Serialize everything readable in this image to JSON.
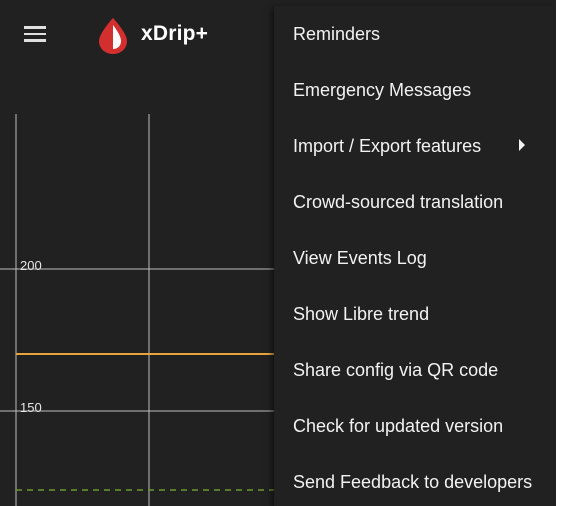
{
  "app": {
    "title": "xDrip+",
    "logo_icon": "blood-drop-icon",
    "menu_icon": "hamburger-menu-icon"
  },
  "chart": {
    "y_ticks": [
      "200",
      "150"
    ],
    "colors": {
      "grid": "#bdbdbd",
      "high_line": "#e8a33d",
      "low_line": "#6a9a2c"
    }
  },
  "menu": {
    "items": [
      {
        "label": "Reminders"
      },
      {
        "label": "Emergency Messages"
      },
      {
        "label": "Import / Export features",
        "submenu_icon": "arrow-right-icon"
      },
      {
        "label": "Crowd-sourced translation"
      },
      {
        "label": "View Events Log"
      },
      {
        "label": "Show Libre trend"
      },
      {
        "label": "Share config via QR code"
      },
      {
        "label": "Check for updated version"
      },
      {
        "label": "Send Feedback to developers"
      }
    ]
  }
}
